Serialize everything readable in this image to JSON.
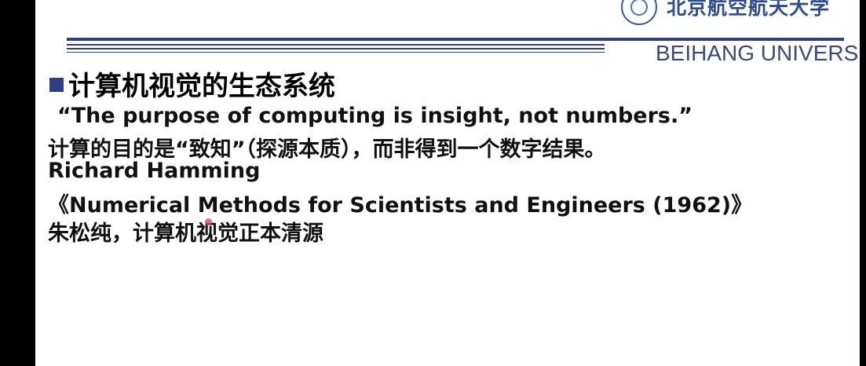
{
  "header": {
    "university_cn": "北京航空航天大学",
    "university_en": "BEIHANG UNIVERSITY"
  },
  "slide": {
    "heading": "计算机视觉的生态系统",
    "lines": [
      "“The purpose of computing is insight, not numbers.”",
      "计算的目的是“致知”（探源本质），而非得到一个数字结果。",
      "Richard Hamming",
      "《Numerical Methods for Scientists and Engineers (1962)》",
      "朱松纯，计算机视觉正本清源"
    ]
  },
  "colors": {
    "accent": "#2e3f8a",
    "background_frame": "#000000",
    "slide_background": "#ffffff"
  }
}
